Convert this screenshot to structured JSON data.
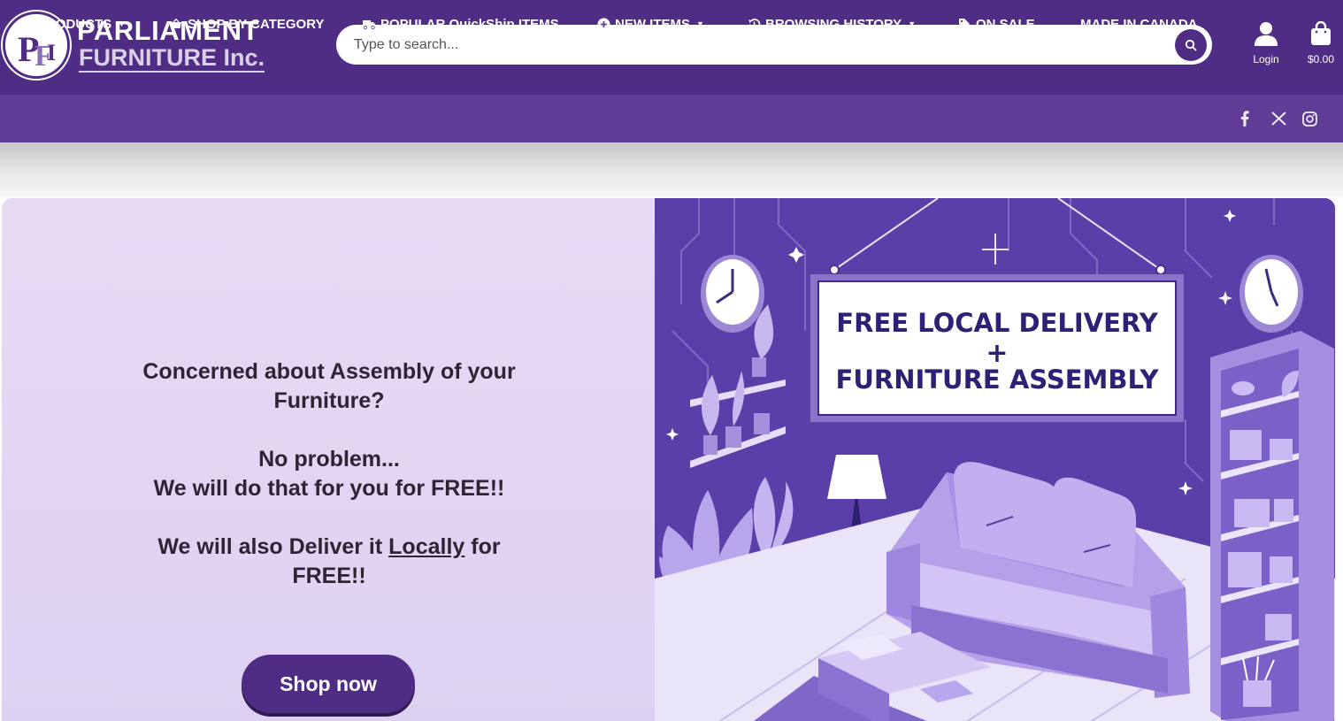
{
  "brand": {
    "name_line1": "PARLIAMENT",
    "name_line2": "FURNITURE Inc.",
    "primary_color": "#4f2d84",
    "nav_color": "#5f3d96",
    "logo_mark_letters": "PFI"
  },
  "search": {
    "placeholder": "Type to search..."
  },
  "account": {
    "login_label": "Login",
    "cart_total": "$0.00"
  },
  "nav": {
    "items": [
      {
        "label": "PRODUCTS",
        "icon": "basket-icon",
        "dropdown": true
      },
      {
        "label": "SHOP BY CATEGORY",
        "icon": "basket-icon",
        "dropdown": false
      },
      {
        "label": "POPULAR QuickShip ITEMS",
        "icon": "truck-icon",
        "dropdown": false
      },
      {
        "label": "NEW ITEMS",
        "icon": "plus-circle-icon",
        "dropdown": true
      },
      {
        "label": "BROWSING HISTORY",
        "icon": "history-icon",
        "dropdown": true
      },
      {
        "label": "ON SALE",
        "icon": "sale-tag-icon",
        "dropdown": false
      },
      {
        "label": "MADE IN CANADA",
        "icon": "",
        "dropdown": false
      }
    ],
    "social": [
      "facebook-icon",
      "x-icon",
      "instagram-icon"
    ]
  },
  "hero": {
    "line1": "Concerned about Assembly of your Furniture?",
    "line2": "No problem...",
    "line3": "We will do that for you for FREE!!",
    "line4_pre": "We will also Deliver it ",
    "line4_underlined": "Locally",
    "line4_post": " for FREE!!",
    "cta_label": "Shop now",
    "sign_line1": "FREE LOCAL DELIVERY",
    "sign_plus": "+",
    "sign_line2": "FURNITURE ASSEMBLY"
  }
}
